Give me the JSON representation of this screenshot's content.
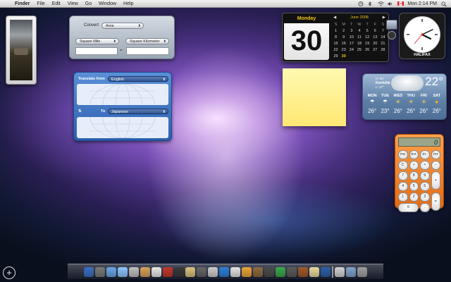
{
  "menubar": {
    "app": "Finder",
    "items": [
      "File",
      "Edit",
      "View",
      "Go",
      "Window",
      "Help"
    ],
    "clock": "Mon 2:14 PM"
  },
  "converter": {
    "convert_label": "Convert",
    "type": "Area",
    "from_unit": "Square Mile",
    "to_unit": "Square Kilometer",
    "equals": "="
  },
  "translate": {
    "from_label": "Translate from",
    "from_lang": "English",
    "to_label": "To",
    "to_lang": "Japanese"
  },
  "calendar": {
    "day_name": "Monday",
    "day_number": "30",
    "month": "June 2008",
    "weekday_headers": [
      "S",
      "M",
      "T",
      "W",
      "T",
      "F",
      "S"
    ],
    "dates": [
      "1",
      "2",
      "3",
      "4",
      "5",
      "6",
      "7",
      "8",
      "9",
      "10",
      "11",
      "12",
      "13",
      "14",
      "15",
      "16",
      "17",
      "18",
      "19",
      "20",
      "21",
      "22",
      "23",
      "24",
      "25",
      "26",
      "27",
      "28",
      "29",
      "30"
    ],
    "today": "30"
  },
  "clock": {
    "city": "HALIFAX"
  },
  "weather": {
    "current": "22°",
    "hi": "H: 26°",
    "city": "Kentville",
    "lo": "L: 17°",
    "forecast": [
      {
        "day": "MON",
        "temp": "26°"
      },
      {
        "day": "TUE",
        "temp": "23°"
      },
      {
        "day": "WED",
        "temp": "26°"
      },
      {
        "day": "THU",
        "temp": "26°"
      },
      {
        "day": "FRI",
        "temp": "26°"
      },
      {
        "day": "SAT",
        "temp": "26°"
      }
    ]
  },
  "calculator": {
    "display": "0",
    "keys": [
      "mc",
      "m+",
      "m-",
      "mr",
      "C",
      "÷",
      "×",
      "−",
      "7",
      "8",
      "9",
      "+",
      "4",
      "5",
      "6",
      "1",
      "2",
      "3",
      "=",
      "0",
      "."
    ]
  },
  "add_widget": "+",
  "dock": {
    "icon_colors": [
      "#3b6fc2",
      "#7a7a7a",
      "#6aa6e8",
      "#8cc6ff",
      "#bfbfbf",
      "#d6a25a",
      "#e8e8e8",
      "#c0392b",
      "#3a3a3a",
      "#d9c27a",
      "#666666",
      "#cccccc",
      "#2c7fd6",
      "#e3e3e3",
      "#e9a63a",
      "#8e6b3f",
      "#4c4c4c",
      "#3aa84a",
      "#5c5c5c",
      "#a05a2c",
      "#e8d9a0",
      "#2f5faa",
      "#d2d2d2",
      "#7fa4cc",
      "#9e9e9e"
    ]
  }
}
